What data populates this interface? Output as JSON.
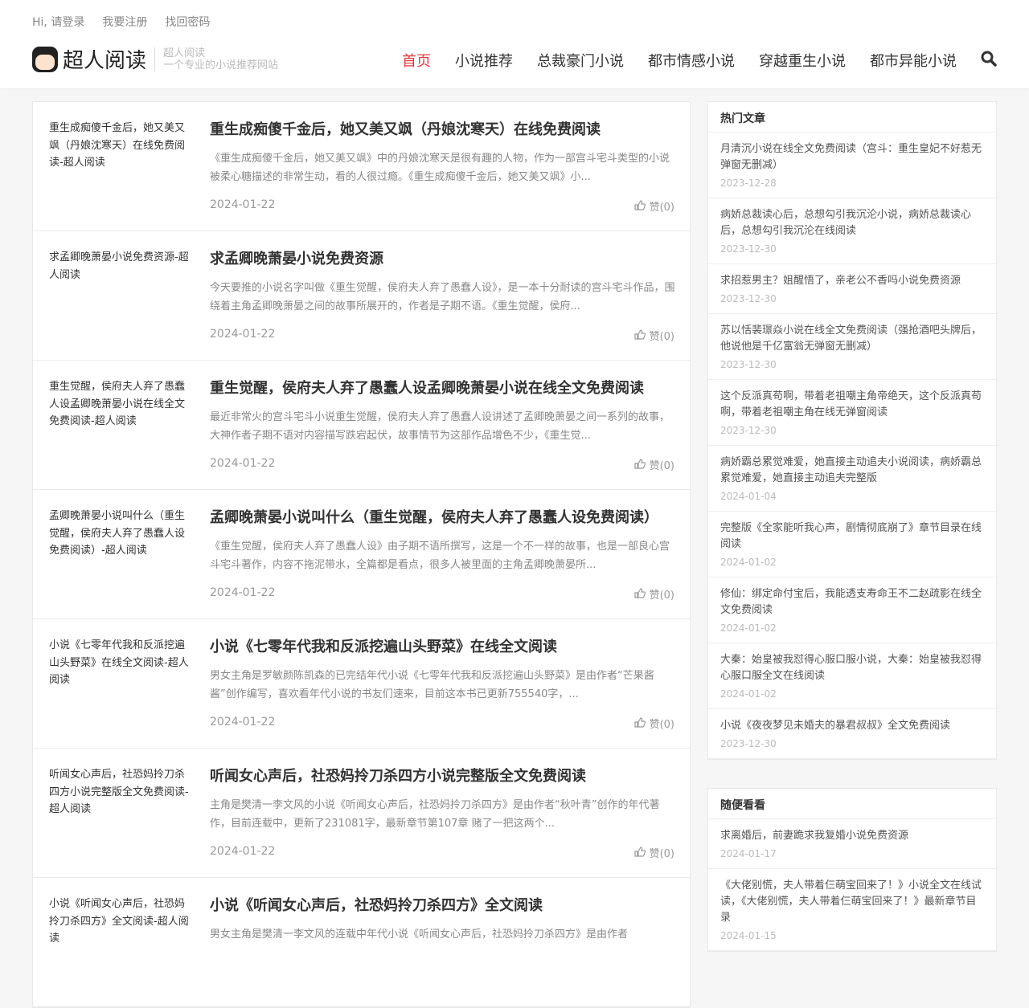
{
  "topbar": {
    "login": "Hi, 请登录",
    "register": "我要注册",
    "recover": "找回密码"
  },
  "logo": {
    "name": "超人阅读",
    "slogan_title": "超人阅读",
    "slogan": "一个专业的小说推荐网站"
  },
  "nav": [
    "首页",
    "小说推荐",
    "总裁豪门小说",
    "都市情感小说",
    "穿越重生小说",
    "都市异能小说"
  ],
  "articles": [
    {
      "side": "重生成痴傻千金后，她又美又飒（丹娘沈寒天）在线免费阅读-超人阅读",
      "title": "重生成痴傻千金后，她又美又飒（丹娘沈寒天）在线免费阅读",
      "desc": "《重生成痴傻千金后，她又美又飒》中的丹娘沈寒天是很有趣的人物，作为一部宫斗宅斗类型的小说被柔心糖描述的非常生动，看的人很过瘾。《重生成痴傻千金后，她又美又飒》小...",
      "date": "2024-01-22",
      "like": "赞(0)"
    },
    {
      "side": "求孟卿晚萧晏小说免费资源-超人阅读",
      "title": "求孟卿晚萧晏小说免费资源",
      "desc": "今天要推的小说名字叫做《重生觉醒，侯府夫人弃了愚蠢人设》，是一本十分耐读的宫斗宅斗作品，围绕着主角孟卿晚萧晏之间的故事所展开的，作者是子期不语。《重生觉醒，侯府...",
      "date": "2024-01-22",
      "like": "赞(0)"
    },
    {
      "side": "重生觉醒，侯府夫人弃了愚蠢人设孟卿晚萧晏小说在线全文免费阅读-超人阅读",
      "title": "重生觉醒，侯府夫人弃了愚蠢人设孟卿晚萧晏小说在线全文免费阅读",
      "desc": "最近非常火的宫斗宅斗小说重生觉醒，侯府夫人弃了愚蠢人设讲述了孟卿晚萧晏之间一系列的故事，大神作者子期不语对内容描写跌宕起伏，故事情节为这部作品增色不少，《重生觉...",
      "date": "2024-01-22",
      "like": "赞(0)"
    },
    {
      "side": "孟卿晚萧晏小说叫什么（重生觉醒，侯府夫人弃了愚蠢人设免费阅读）-超人阅读",
      "title": "孟卿晚萧晏小说叫什么（重生觉醒，侯府夫人弃了愚蠢人设免费阅读）",
      "desc": "《重生觉醒，侯府夫人弃了愚蠢人设》由子期不语所撰写，这是一个不一样的故事，也是一部良心宫斗宅斗著作，内容不拖泥带水，全篇都是看点，很多人被里面的主角孟卿晚萧晏所...",
      "date": "2024-01-22",
      "like": "赞(0)"
    },
    {
      "side": "小说《七零年代我和反派挖遍山头野菜》在线全文阅读-超人阅读",
      "title": "小说《七零年代我和反派挖遍山头野菜》在线全文阅读",
      "desc": "男女主角是罗敏颜陈凯森的已完结年代小说《七零年代我和反派挖遍山头野菜》是由作者“芒果酱酱”创作编写，喜欢看年代小说的书友们速来，目前这本书已更新755540字，...",
      "date": "2024-01-22",
      "like": "赞(0)"
    },
    {
      "side": "听闻女心声后，社恐妈拎刀杀四方小说完整版全文免费阅读-超人阅读",
      "title": "听闻女心声后，社恐妈拎刀杀四方小说完整版全文免费阅读",
      "desc": "主角是樊清一李文风的小说《听闻女心声后，社恐妈拎刀杀四方》是由作者“秋叶青”创作的年代著作，目前连载中，更新了231081字，最新章节第107章 赌了一把这两个...",
      "date": "2024-01-22",
      "like": "赞(0)"
    },
    {
      "side": "小说《听闻女心声后，社恐妈拎刀杀四方》全文阅读-超人阅读",
      "title": "小说《听闻女心声后，社恐妈拎刀杀四方》全文阅读",
      "desc": "男女主角是樊清一李文风的连载中年代小说《听闻女心声后，社恐妈拎刀杀四方》是由作者",
      "date": "",
      "like": ""
    }
  ],
  "hot": {
    "title": "热门文章",
    "items": [
      {
        "t": "月清沉小说在线全文免费阅读（宫斗：重生皇妃不好惹无弹窗无删减）",
        "d": "2023-12-28"
      },
      {
        "t": "病娇总裁读心后，总想勾引我沉沦小说，病娇总裁读心后，总想勾引我沉沦在线阅读",
        "d": "2023-12-30"
      },
      {
        "t": "求招惹男主？姐醒悟了，亲老公不香吗小说免费资源",
        "d": "2023-12-30"
      },
      {
        "t": "苏以恬裴璟焱小说在线全文免费阅读（强抢酒吧头牌后，他说他是千亿富翁无弹窗无删减）",
        "d": "2023-12-30"
      },
      {
        "t": "这个反派真苟啊，带着老祖嘲主角帝绝天，这个反派真苟啊，带着老祖嘲主角在线无弹窗阅读",
        "d": "2023-12-30"
      },
      {
        "t": "病娇霸总累觉难爱，她直接主动追夫小说阅读，病娇霸总累觉难爱，她直接主动追夫完整版",
        "d": "2024-01-04"
      },
      {
        "t": "完整版《全家能听我心声，剧情彻底崩了》章节目录在线阅读",
        "d": "2024-01-02"
      },
      {
        "t": "修仙：绑定命付宝后，我能透支寿命王不二赵疏影在线全文免费阅读",
        "d": "2024-01-02"
      },
      {
        "t": "大秦：始皇被我怼得心服口服小说，大秦：始皇被我怼得心服口服全文在线阅读",
        "d": "2024-01-02"
      },
      {
        "t": "小说《夜夜梦见未婚夫的暴君叔叔》全文免费阅读",
        "d": "2023-12-30"
      }
    ]
  },
  "random": {
    "title": "随便看看",
    "items": [
      {
        "t": "求离婚后，前妻跪求我复婚小说免费资源",
        "d": "2024-01-17"
      },
      {
        "t": "《大佬别慌，夫人带着仨萌宝回来了！》小说全文在线试读，《大佬别慌，夫人带着仨萌宝回来了！》最新章节目录",
        "d": "2024-01-15"
      }
    ]
  }
}
